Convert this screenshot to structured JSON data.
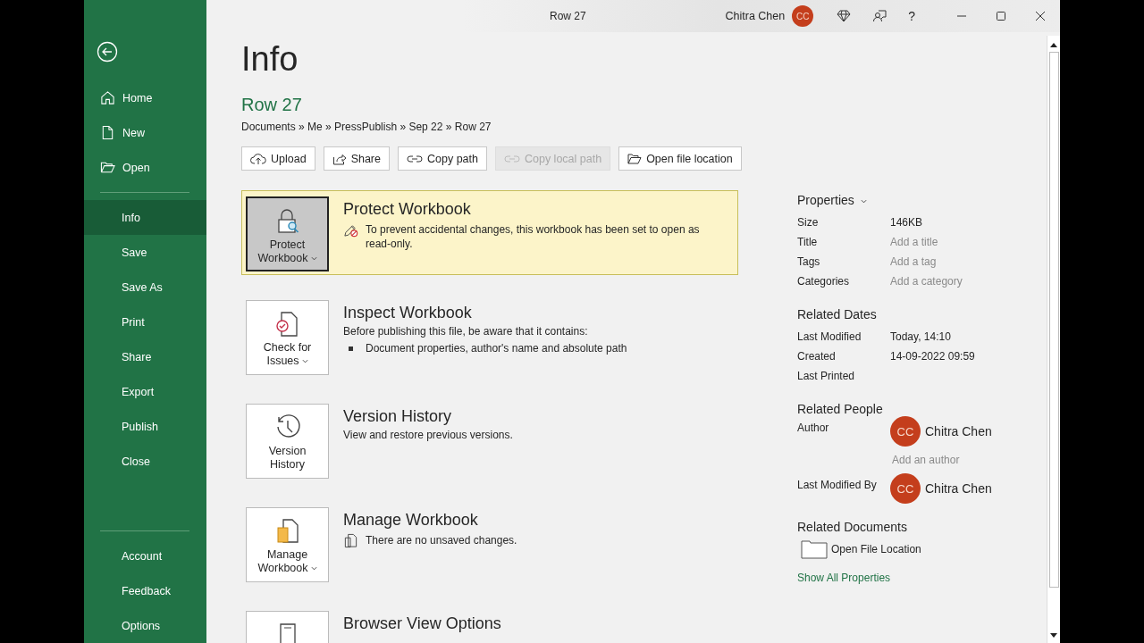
{
  "window": {
    "title": "Row 27",
    "user": {
      "name": "Chitra Chen",
      "initials": "CC"
    },
    "help": "?"
  },
  "sidebar": {
    "top_items": [
      {
        "label": "Home",
        "selected": false
      },
      {
        "label": "New",
        "selected": false
      },
      {
        "label": "Open",
        "selected": false
      }
    ],
    "middle_items": [
      {
        "label": "Info",
        "selected": true
      },
      {
        "label": "Save",
        "selected": false
      },
      {
        "label": "Save As",
        "selected": false
      },
      {
        "label": "Print",
        "selected": false
      },
      {
        "label": "Share",
        "selected": false
      },
      {
        "label": "Export",
        "selected": false
      },
      {
        "label": "Publish",
        "selected": false
      },
      {
        "label": "Close",
        "selected": false
      }
    ],
    "bottom_items": [
      {
        "label": "Account",
        "selected": false
      },
      {
        "label": "Feedback",
        "selected": false
      },
      {
        "label": "Options",
        "selected": false
      }
    ]
  },
  "page": {
    "heading": "Info",
    "file_name": "Row 27",
    "path": "Documents » Me » PressPublish » Sep 22 » Row 27",
    "actions": [
      {
        "label": "Upload",
        "disabled": false
      },
      {
        "label": "Share",
        "disabled": false
      },
      {
        "label": "Copy path",
        "disabled": false
      },
      {
        "label": "Copy local path",
        "disabled": true
      },
      {
        "label": "Open file location",
        "disabled": false
      }
    ],
    "sections": [
      {
        "button": "Protect Workbook",
        "dropdown": true,
        "highlighted": true,
        "title": "Protect Workbook",
        "note": "To prevent accidental changes, this workbook has been set to open as read-only."
      },
      {
        "button": "Check for Issues",
        "dropdown": true,
        "highlighted": false,
        "title": "Inspect Workbook",
        "description": "Before publishing this file, be aware that it contains:",
        "bullets": [
          "Document properties, author's name and absolute path"
        ]
      },
      {
        "button": "Version History",
        "dropdown": false,
        "highlighted": false,
        "title": "Version History",
        "description": "View and restore previous versions."
      },
      {
        "button": "Manage Workbook",
        "dropdown": true,
        "highlighted": false,
        "title": "Manage Workbook",
        "note": "There are no unsaved changes."
      },
      {
        "highlighted": false,
        "title": "Browser View Options"
      }
    ]
  },
  "properties": {
    "heading": "Properties",
    "rows": [
      {
        "label": "Size",
        "value": "146KB"
      },
      {
        "label": "Title",
        "placeholder": "Add a title"
      },
      {
        "label": "Tags",
        "placeholder": "Add a tag"
      },
      {
        "label": "Categories",
        "placeholder": "Add a category"
      }
    ],
    "dates_heading": "Related Dates",
    "dates": [
      {
        "label": "Last Modified",
        "value": "Today, 14:10"
      },
      {
        "label": "Created",
        "value": "14-09-2022 09:59"
      },
      {
        "label": "Last Printed"
      }
    ],
    "people_heading": "Related People",
    "author_label": "Author",
    "author": {
      "initials": "CC",
      "name": "Chitra Chen"
    },
    "add_author": "Add an author",
    "modified_label": "Last Modified By",
    "modified_by": {
      "initials": "CC",
      "name": "Chitra Chen"
    },
    "documents_heading": "Related Documents",
    "open_location": "Open File Location",
    "show_all": "Show All Properties"
  }
}
